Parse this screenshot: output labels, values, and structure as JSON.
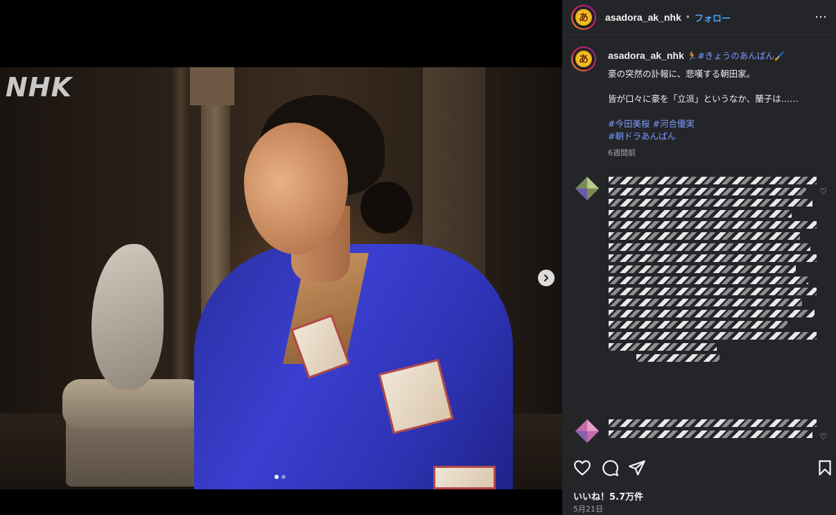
{
  "post": {
    "username": "asadora_ak_nhk",
    "separator": "•",
    "follow_label": "フォロー",
    "more_label": "⋯",
    "avatar_glyph": "あ"
  },
  "media": {
    "watermark": "NHK",
    "next_icon": "chevron-right-icon",
    "carousel": {
      "count": 2,
      "active_index": 0
    }
  },
  "caption": {
    "username": "asadora_ak_nhk",
    "emoji_runner": "🏃",
    "headline_tag": "#きょうのあんぱん",
    "emoji_brush": "🖌️",
    "line1": "豪の突然の訃報に、悲嘆する朝田家。",
    "line2": "皆が口々に豪を「立派」というなか、蘭子は……",
    "tags_line1": "#今田美桜 #河合優実",
    "tags_line2": "#朝ドラあんぱん",
    "time": "6週間前"
  },
  "actions": {
    "like_icon": "heart-icon",
    "comment_icon": "comment-icon",
    "share_icon": "paper-plane-icon",
    "save_icon": "bookmark-icon"
  },
  "footer": {
    "likes": "いいね！5.7万件",
    "date": "5月21日"
  },
  "colors": {
    "panel_bg": "#242529",
    "link": "#4aa3ff",
    "hashtag": "#7c9cff",
    "kimono": "#3a3fd0"
  }
}
